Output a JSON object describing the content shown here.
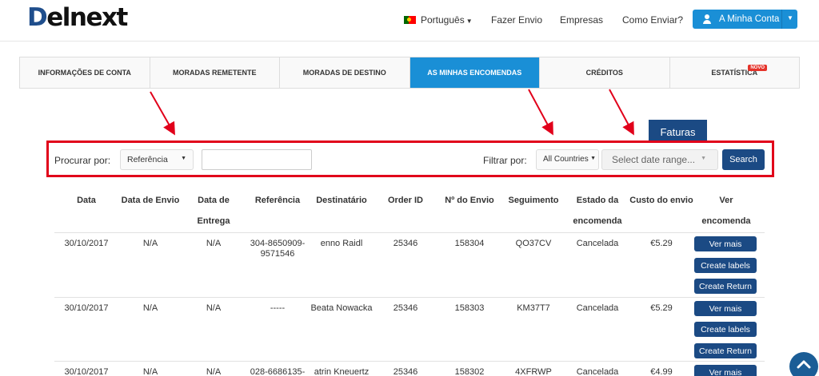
{
  "header": {
    "logo_text": "elnext",
    "logo_d": "D",
    "language": "Português",
    "nav": [
      "Fazer Envio",
      "Empresas",
      "Como Enviar?"
    ],
    "account_label": "A Minha Conta"
  },
  "tabs": [
    {
      "label": "INFORMAÇÕES DE CONTA"
    },
    {
      "label": "MORADAS REMETENTE"
    },
    {
      "label": "MORADAS DE DESTINO"
    },
    {
      "label": "AS MINHAS ENCOMENDAS"
    },
    {
      "label": "CRÉDITOS"
    },
    {
      "label": "ESTATÍSTICA"
    }
  ],
  "tab_badge": "NOVO",
  "faturas_label": "Faturas",
  "filters": {
    "search_by_label": "Procurar por:",
    "search_by_value": "Referência",
    "filter_label": "Filtrar por:",
    "country_value": "All Countries",
    "date_placeholder": "Select date range...",
    "search_button": "Search"
  },
  "table": {
    "headers": [
      "Data",
      "Data de Envio",
      "Data de Entrega",
      "Referência",
      "Destinatário",
      "Order ID",
      "Nº do Envio",
      "Seguimento",
      "Estado da",
      "encomenda",
      "Custo do envio",
      "Ver encomenda"
    ],
    "rows": [
      {
        "data": "30/10/2017",
        "envio": "N/A",
        "entrega": "N/A",
        "ref1": "304-8650909-",
        "ref2": "9571546",
        "dest": "enno Raidl",
        "order": "25346",
        "num": "158304",
        "seg": "QO37CV",
        "estado": "Cancelada",
        "custo": "€5.29"
      },
      {
        "data": "30/10/2017",
        "envio": "N/A",
        "entrega": "N/A",
        "ref1": "-----",
        "ref2": "",
        "dest": "Beata Nowacka",
        "order": "25346",
        "num": "158303",
        "seg": "KM37T7",
        "estado": "Cancelada",
        "custo": "€5.29"
      },
      {
        "data": "30/10/2017",
        "envio": "N/A",
        "entrega": "N/A",
        "ref1": "028-6686135-",
        "ref2": "",
        "dest": "atrin Kneuertz",
        "order": "25346",
        "num": "158302",
        "seg": "4XFRWP",
        "estado": "Cancelada",
        "custo": "€4.99"
      }
    ],
    "actions": [
      "Ver mais",
      "Create labels",
      "Create Return"
    ]
  },
  "colors": {
    "primary_blue": "#1a8fd6",
    "dark_blue": "#1b4a84",
    "highlight_red": "#e1001a"
  }
}
